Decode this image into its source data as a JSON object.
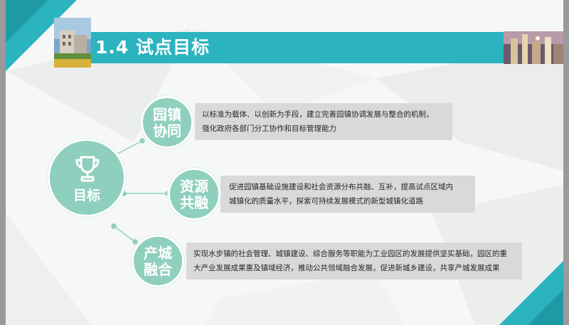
{
  "header": {
    "title": "1.4 试点目标"
  },
  "colors": {
    "accent": "#2bb3c0",
    "circle": "#8fcfbd",
    "box": "#d9d9d9"
  },
  "center": {
    "label": "目标",
    "icon": "trophy-icon"
  },
  "items": [
    {
      "title_line1": "园镇",
      "title_line2": "协同",
      "text_line1": "以标准为载体、以创新为手段，建立完善园镇协调发展与整合的机制，",
      "text_line2": "强化政府各部门分工协作和目标管理能力"
    },
    {
      "title_line1": "资源",
      "title_line2": "共融",
      "text_line1": "促进园镇基础设施建设和社会资源分布共融、互补，提高试点区域内",
      "text_line2": "城镇化的质量水平，探索可持续发展模式的新型城镇化道路"
    },
    {
      "title_line1": "产城",
      "title_line2": "融合",
      "text_line1": "实现水步镇的社会管理、城镇建设、综合服务等职能为工业园区的发展提供坚实基础，园区的重",
      "text_line2": "大产业发展成果惠及镇域经济，推动公共领域融合发展，促进新城乡建设，共享产城发展成果"
    }
  ]
}
